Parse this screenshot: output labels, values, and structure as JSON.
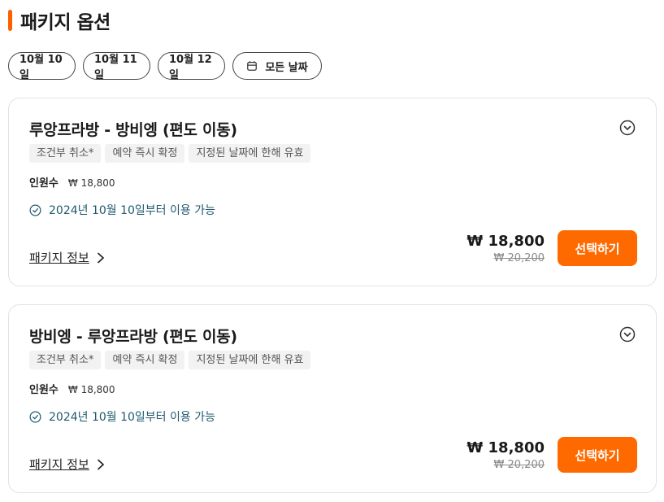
{
  "section": {
    "title": "패키지 옵션",
    "accent_color": "#ff5f00"
  },
  "date_filters": [
    {
      "label": "10월 10일"
    },
    {
      "label": "10월 11일"
    },
    {
      "label": "10월 12일"
    },
    {
      "label": "모든 날짜",
      "icon": "calendar-icon"
    }
  ],
  "packages": [
    {
      "name": "루앙프라방 - 방비엥 (편도 이동)",
      "tags": [
        "조건부 취소*",
        "예약 즉시 확정",
        "지정된 날짜에 한해 유효"
      ],
      "pax_label": "인원수",
      "pax_price": "₩ 18,800",
      "availability": "2024년 10월 10일부터 이용 가능",
      "info_link": "패키지 정보",
      "price": "₩ 18,800",
      "original_price": "₩ 20,200",
      "select_label": "선택하기"
    },
    {
      "name": "방비엥 - 루앙프라방 (편도 이동)",
      "tags": [
        "조건부 취소*",
        "예약 즉시 확정",
        "지정된 날짜에 한해 유효"
      ],
      "pax_label": "인원수",
      "pax_price": "₩ 18,800",
      "availability": "2024년 10월 10일부터 이용 가능",
      "info_link": "패키지 정보",
      "price": "₩ 18,800",
      "original_price": "₩ 20,200",
      "select_label": "선택하기"
    }
  ],
  "colors": {
    "button": "#ff6a00",
    "availability_text": "#1f5a6e",
    "tag_bg": "#f2f2f2"
  }
}
